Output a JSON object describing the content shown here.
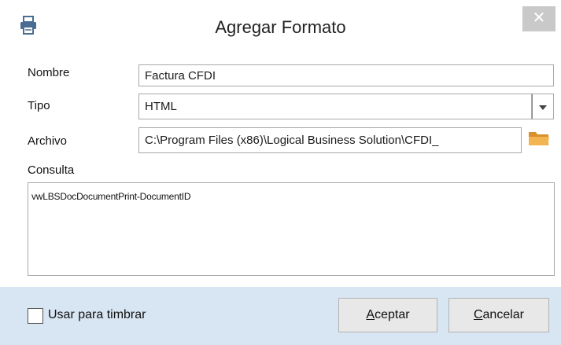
{
  "window": {
    "title": "Agregar Formato",
    "icon": "printer-icon",
    "close_glyph": "✕"
  },
  "form": {
    "nombre": {
      "label": "Nombre",
      "value": "Factura CFDI"
    },
    "tipo": {
      "label": "Tipo",
      "value": "HTML",
      "dropdown_icon": "chevron-down-icon"
    },
    "archivo": {
      "label": "Archivo",
      "value": "C:\\Program Files (x86)\\Logical Business Solution\\CFDI_",
      "browse_icon": "folder-icon"
    },
    "consulta": {
      "label": "Consulta",
      "value": "vwLBSDocDocumentPrint-DocumentID"
    }
  },
  "footer": {
    "checkbox_label": "Usar para timbrar",
    "checkbox_checked": false,
    "aceptar": {
      "accel": "A",
      "rest": "ceptar"
    },
    "cancelar": {
      "accel": "C",
      "rest": "ancelar"
    }
  },
  "colors": {
    "footer_bg": "#d8e5f2",
    "close_bg": "#c9c9c9",
    "folder": "#e8a33c"
  }
}
